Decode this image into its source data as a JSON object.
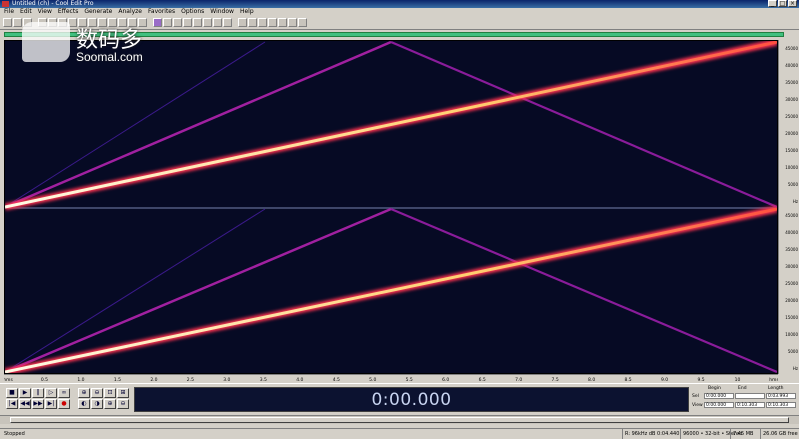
{
  "window": {
    "title": "Untitled (ch) - Cool Edit Pro"
  },
  "menu": [
    "File",
    "Edit",
    "View",
    "Effects",
    "Generate",
    "Analyze",
    "Favorites",
    "Options",
    "Window",
    "Help"
  ],
  "watermark": {
    "brand": "数码多",
    "site": "Soomal.com"
  },
  "freq_ruler": [
    "45000",
    "40000",
    "35000",
    "30000",
    "25000",
    "20000",
    "15000",
    "10000",
    "5000",
    "Hz"
  ],
  "time_ruler": [
    "hms",
    "0.5",
    "1.0",
    "1.5",
    "2.0",
    "2.5",
    "3.0",
    "3.5",
    "4.0",
    "4.5",
    "5.0",
    "5.5",
    "6.0",
    "6.5",
    "7.0",
    "7.5",
    "8.0",
    "8.5",
    "9.0",
    "9.5",
    "10",
    "hms"
  ],
  "time_display": "0:00.000",
  "selection": {
    "headers": [
      "Begin",
      "End",
      "Length"
    ],
    "sel_label": "Sel",
    "view_label": "View",
    "sel": [
      "0:00.000",
      "",
      "0:03.993"
    ],
    "view": [
      "0:00.000",
      "0:10.303",
      "0:10.303"
    ]
  },
  "status": {
    "state": "Stopped",
    "level": "R: 96kHz dB  0:04.440",
    "format": "96000 • 32-bit • Stereo",
    "size": "7.45 MB",
    "free": "26.06 GB free"
  },
  "colors": {
    "sweep_hot": "#ffd070",
    "sweep_mid": "#ff4050",
    "harmonic": "#a020a0",
    "background": "#060a24"
  }
}
